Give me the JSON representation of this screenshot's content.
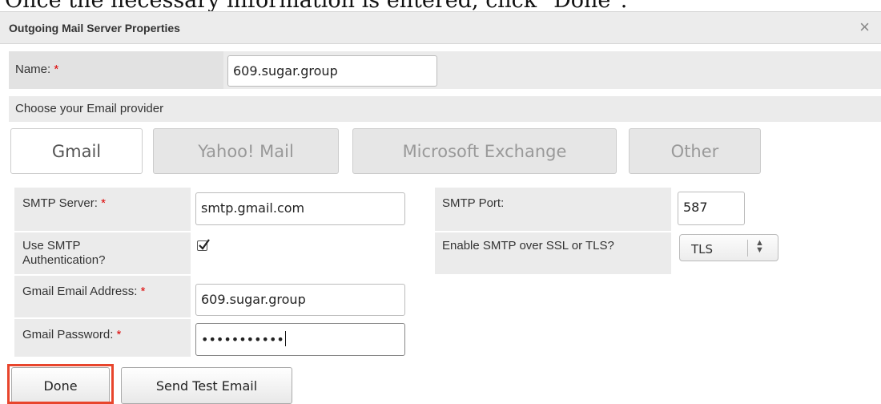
{
  "caption": "Once the necessary information is entered, click \"Done\".",
  "dialog": {
    "title": "Outgoing Mail Server Properties",
    "close_symbol": "×"
  },
  "name_field": {
    "label": "Name:",
    "required": "*",
    "value": "609.sugar.group"
  },
  "provider": {
    "heading": "Choose your Email provider",
    "options": [
      "Gmail",
      "Yahoo! Mail",
      "Microsoft Exchange",
      "Other"
    ],
    "selected": "Gmail"
  },
  "smtp": {
    "server_label": "SMTP Server:",
    "server_required": "*",
    "server_value": "smtp.gmail.com",
    "port_label": "SMTP Port:",
    "port_value": "587",
    "auth_label_line1": "Use SMTP",
    "auth_label_line2": "Authentication?",
    "auth_checked": true,
    "ssl_label": "Enable SMTP over SSL or TLS?",
    "ssl_value": "TLS",
    "email_label": "Gmail Email Address:",
    "email_required": "*",
    "email_value": "609.sugar.group",
    "password_label": "Gmail Password:",
    "password_required": "*",
    "password_masked": "•••••••••••"
  },
  "buttons": {
    "done": "Done",
    "send_test": "Send Test Email"
  },
  "colors": {
    "highlight": "#e8452c",
    "required": "#dd0000",
    "row_grey": "#ebebeb"
  }
}
